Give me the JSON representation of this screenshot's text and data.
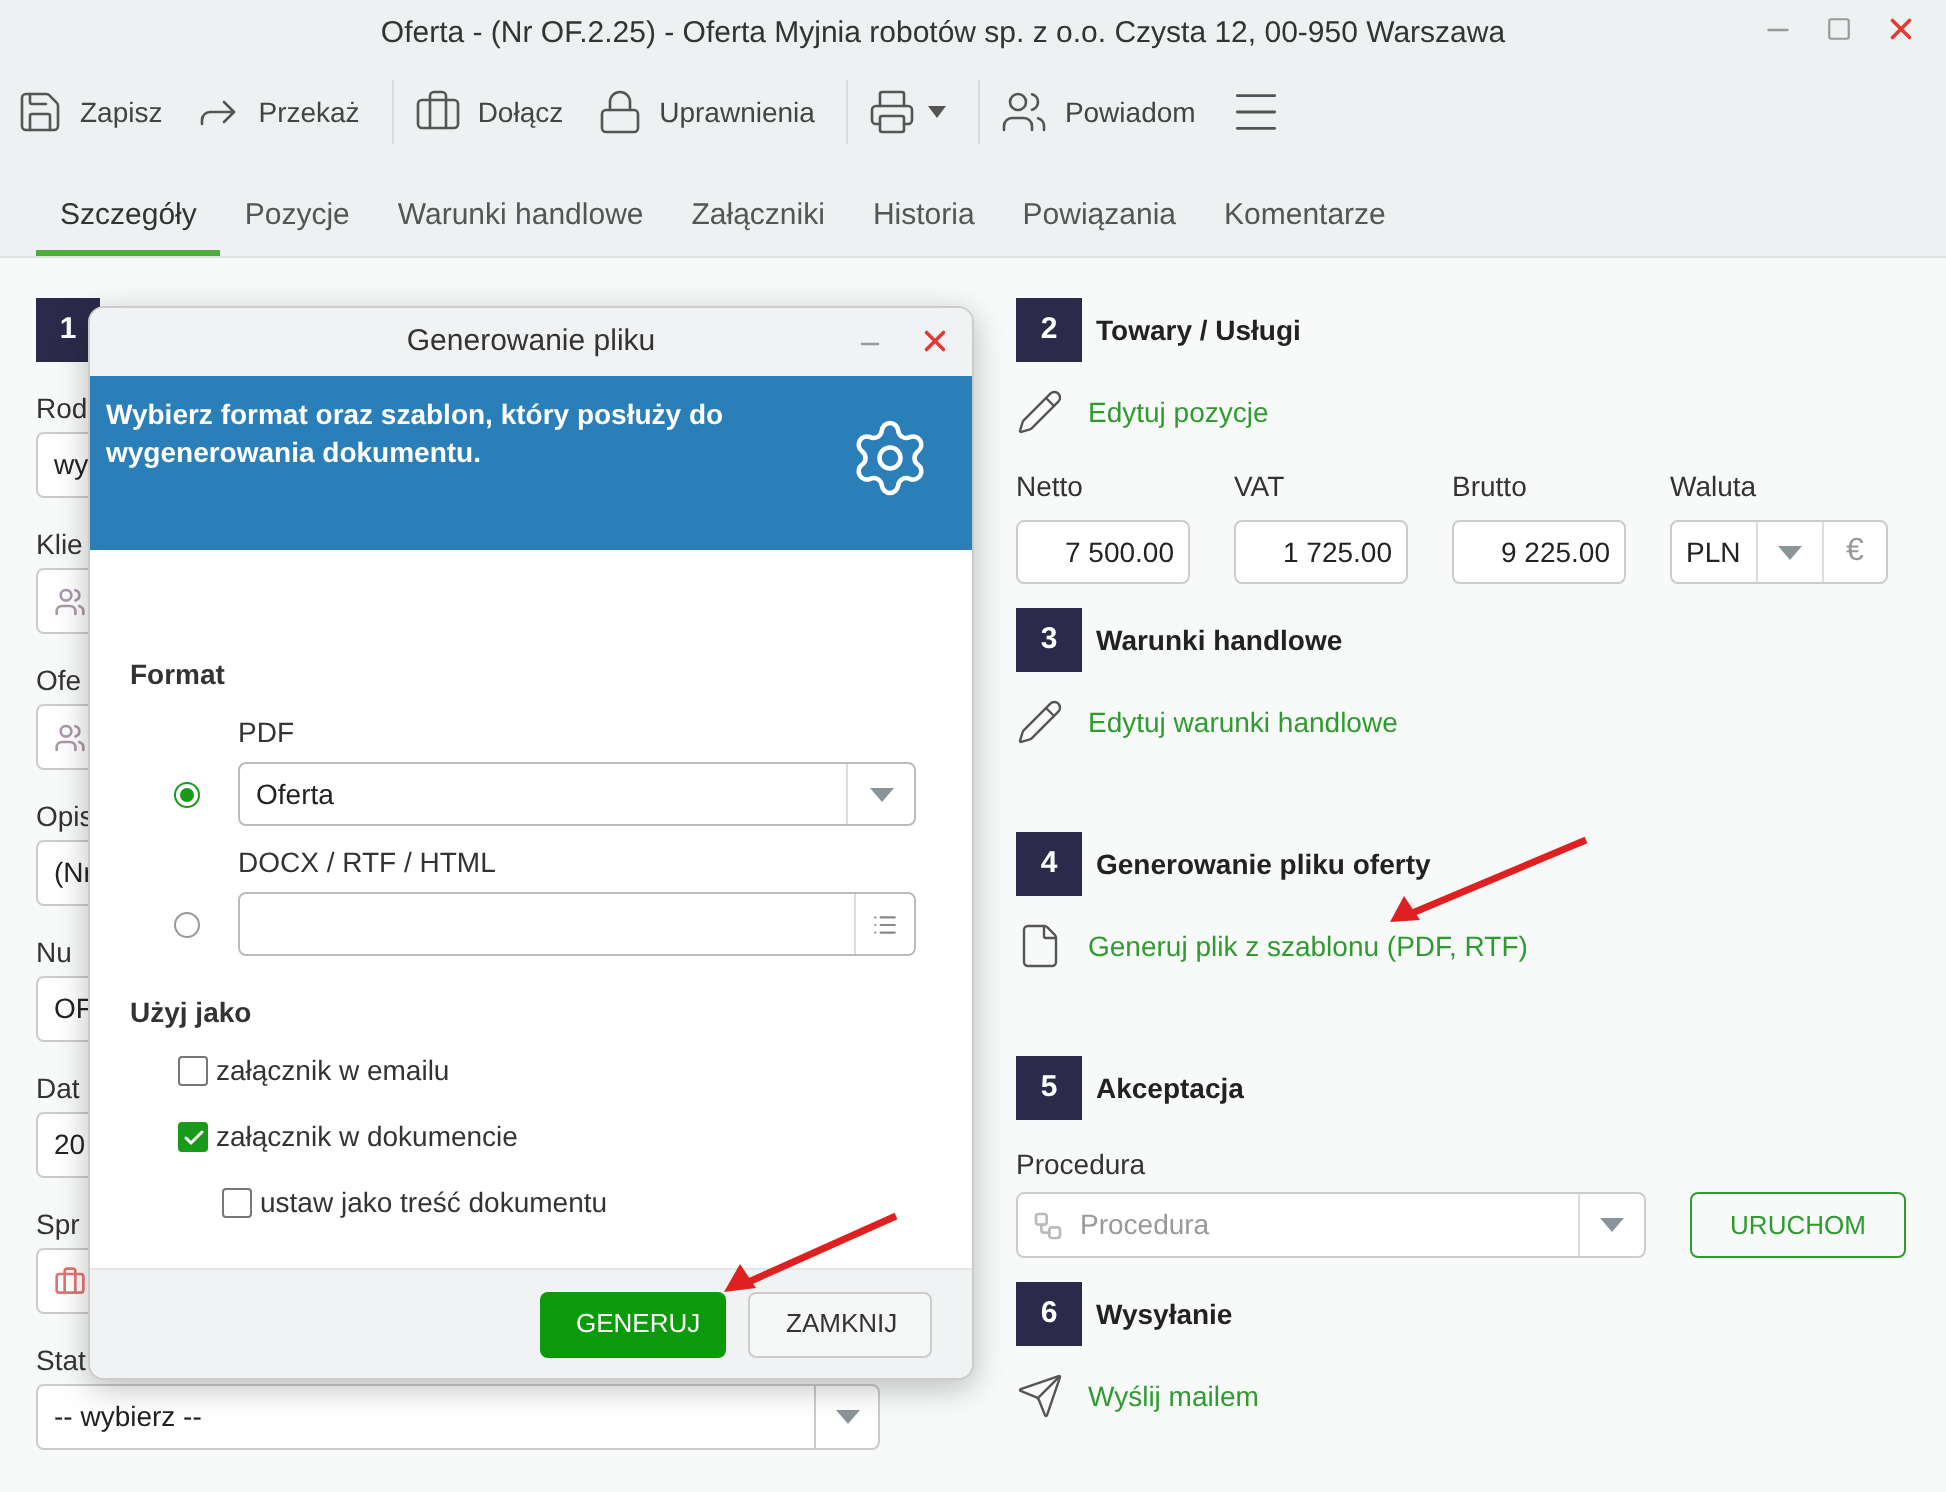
{
  "window": {
    "title": "Oferta - (Nr OF.2.25) - Oferta Myjnia robotów sp. z o.o. Czysta 12, 00-950 Warszawa"
  },
  "toolbar": [
    {
      "label": "Zapisz"
    },
    {
      "label": "Przekaż"
    },
    {
      "label": "Dołącz"
    },
    {
      "label": "Uprawnienia"
    },
    {
      "label": "Powiadom"
    }
  ],
  "tabs": [
    {
      "label": "Szczegóły",
      "selected": true
    },
    {
      "label": "Pozycje",
      "selected": false
    },
    {
      "label": "Warunki handlowe",
      "selected": false
    },
    {
      "label": "Załączniki",
      "selected": false
    },
    {
      "label": "Historia",
      "selected": false
    },
    {
      "label": "Powiązania",
      "selected": false
    },
    {
      "label": "Komentarze",
      "selected": false
    }
  ],
  "left_form": {
    "number": "1",
    "fields": [
      {
        "label": "Rod",
        "kind": "text",
        "value": "wy"
      },
      {
        "label": "Klie",
        "kind": "people"
      },
      {
        "label": "Ofe",
        "kind": "people"
      },
      {
        "label": "Opis",
        "kind": "text",
        "value": "(Nr"
      },
      {
        "label": "Nu",
        "kind": "text",
        "value": "OF"
      },
      {
        "label": "Dat",
        "kind": "text",
        "value": "20"
      },
      {
        "label": "Spr",
        "kind": "briefcase"
      },
      {
        "label": "Stat",
        "kind": "select",
        "value": "-- wybierz --"
      }
    ]
  },
  "dialog": {
    "title": "Generowanie pliku",
    "banner": "Wybierz format oraz szablon, który posłuży do wygenerowania dokumentu.",
    "format_label": "Format",
    "formats": [
      {
        "label": "PDF",
        "kind": "select",
        "value": "Oferta",
        "selected": true
      },
      {
        "label": "DOCX / RTF / HTML",
        "kind": "file",
        "selected": false
      }
    ],
    "use_label": "Użyj jako",
    "checkboxes": [
      {
        "label": "załącznik w emailu",
        "checked": false
      },
      {
        "label": "załącznik w dokumencie",
        "checked": true,
        "children": [
          {
            "label": "ustaw jako treść dokumentu",
            "checked": false
          }
        ]
      }
    ],
    "buttons": [
      {
        "label": "GENERUJ",
        "kind": "primary"
      },
      {
        "label": "ZAMKNIJ",
        "kind": "secondary"
      }
    ]
  },
  "sections": [
    {
      "number": "2",
      "title": "Towary / Usługi",
      "kind": "totals",
      "link": "Edytuj pozycje",
      "totals": [
        {
          "label": "Netto",
          "value": "7 500.00"
        },
        {
          "label": "VAT",
          "value": "1 725.00"
        },
        {
          "label": "Brutto",
          "value": "9 225.00"
        }
      ],
      "currency": {
        "label": "Waluta",
        "value": "PLN",
        "symbol": "€"
      }
    },
    {
      "number": "3",
      "title": "Warunki handlowe",
      "kind": "link",
      "link": "Edytuj warunki handlowe"
    },
    {
      "number": "4",
      "title": "Generowanie pliku oferty",
      "kind": "link",
      "link": "Generuj plik z szablonu (PDF, RTF)"
    },
    {
      "number": "5",
      "title": "Akceptacja",
      "kind": "procedure",
      "field_label": "Procedura",
      "placeholder": "Procedura",
      "button": "URUCHOM"
    },
    {
      "number": "6",
      "title": "Wysyłanie",
      "kind": "link",
      "link": "Wyślij mailem"
    }
  ]
}
